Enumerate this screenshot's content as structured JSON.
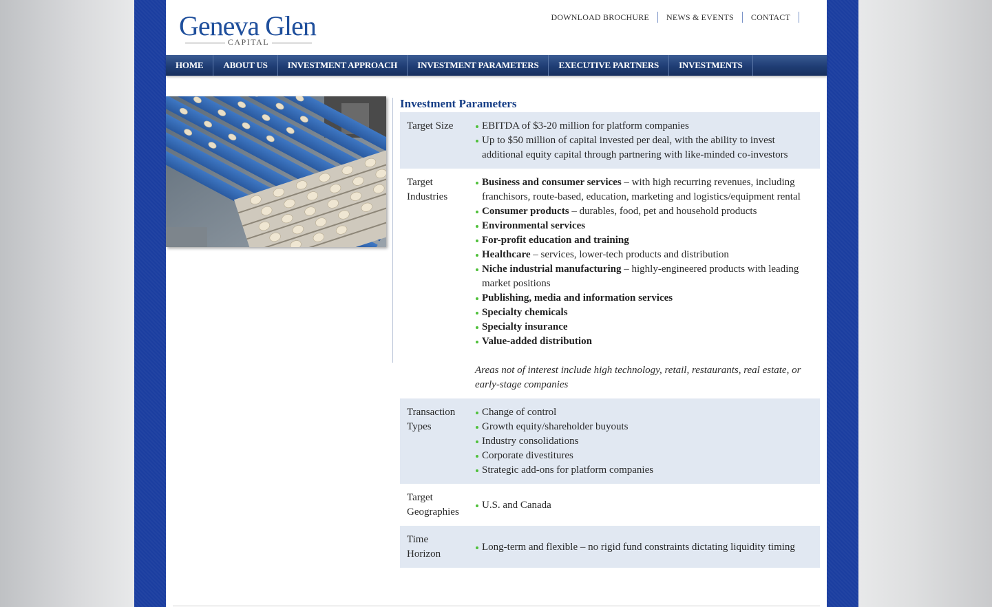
{
  "brand": {
    "name": "Geneva Glen",
    "sub": "CAPITAL"
  },
  "top_nav": [
    "DOWNLOAD BROCHURE",
    "NEWS & EVENTS",
    "CONTACT"
  ],
  "main_nav": [
    "HOME",
    "ABOUT US",
    "INVESTMENT APPROACH",
    "INVESTMENT PARAMETERS",
    "EXECUTIVE PARTNERS",
    "INVESTMENTS"
  ],
  "page_title": "Investment Parameters",
  "target_size": {
    "label": "Target Size",
    "items": [
      "EBITDA of $3-20 million for platform companies",
      "Up to $50 million of capital invested per deal, with the ability to invest additional equity capital through partnering with like-minded co-investors"
    ]
  },
  "target_industries": {
    "label_1": "Target",
    "label_2": "Industries",
    "items": [
      {
        "bold": "Business and consumer services",
        "rest": " – with high recurring revenues, including franchisors, route-based, education, marketing and logistics/equipment rental"
      },
      {
        "bold": "Consumer products",
        "rest": " – durables, food, pet and household products"
      },
      {
        "bold": "Environmental services",
        "rest": ""
      },
      {
        "bold": "For-profit education and training",
        "rest": ""
      },
      {
        "bold": "Healthcare",
        "rest": " – services, lower-tech products and distribution"
      },
      {
        "bold": "Niche industrial manufacturing",
        "rest": " – highly-engineered products with leading market positions"
      },
      {
        "bold": "Publishing, media and information services",
        "rest": ""
      },
      {
        "bold": "Specialty chemicals",
        "rest": ""
      },
      {
        "bold": "Specialty insurance",
        "rest": ""
      },
      {
        "bold": "Value-added distribution",
        "rest": ""
      }
    ],
    "note": "Areas not of interest include high technology, retail, restaurants, real estate, or early-stage companies"
  },
  "transaction_types": {
    "label_1": "Transaction",
    "label_2": "Types",
    "items": [
      "Change of control",
      "Growth equity/shareholder buyouts",
      "Industry consolidations",
      "Corporate divestitures",
      "Strategic add-ons for platform companies"
    ]
  },
  "target_geographies": {
    "label_1": "Target",
    "label_2": "Geographies",
    "items": [
      "U.S. and Canada"
    ]
  },
  "time_horizon": {
    "label_1": "Time",
    "label_2": "Horizon",
    "items": [
      "Long-term and flexible – no rigid fund constraints dictating liquidity timing"
    ]
  },
  "colors": {
    "frame_blue": "#1b3ea0",
    "nav_blue": "#1f3d74",
    "title_blue": "#163e86",
    "row_shade": "#e1e8f2",
    "bullet_green": "#4fc03a"
  }
}
